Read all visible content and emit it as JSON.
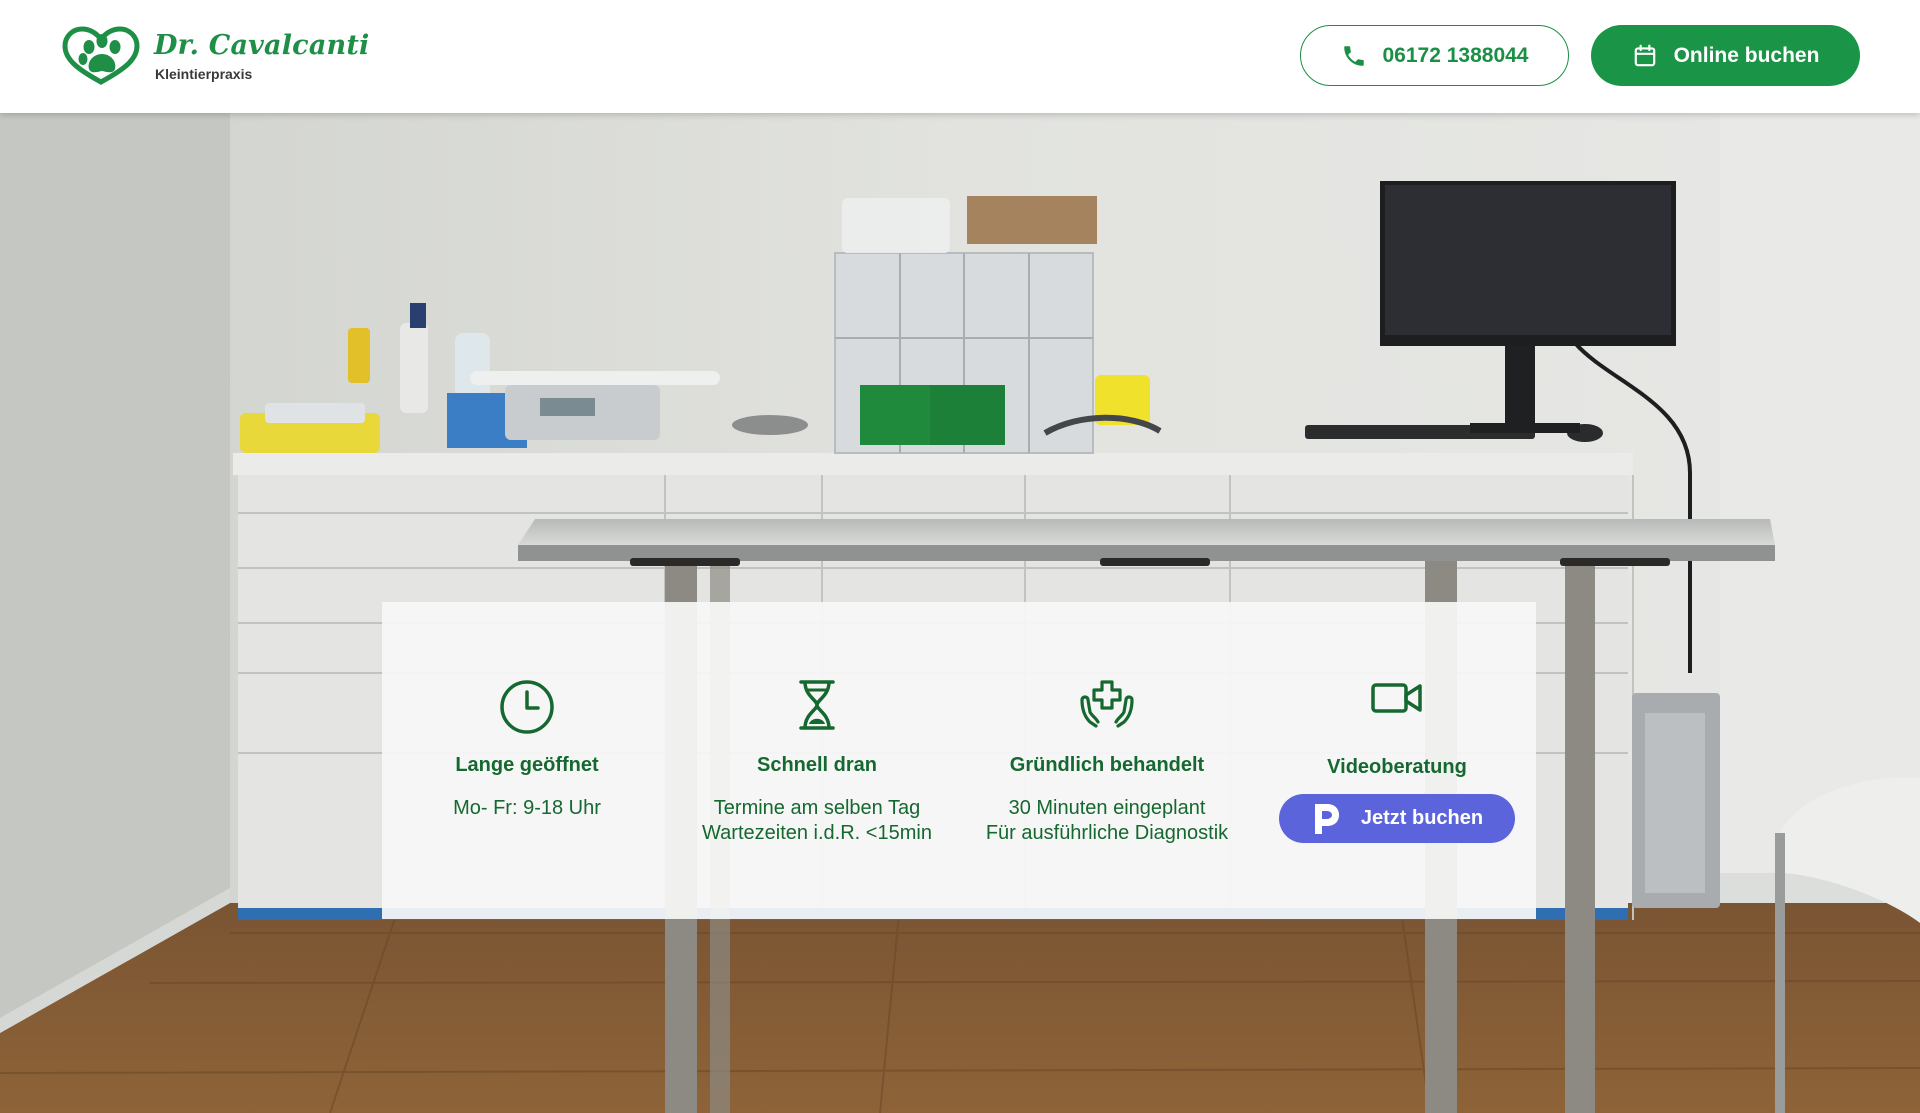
{
  "header": {
    "logo_name": "Dr. Cavalcanti",
    "logo_subtitle": "Kleintierpraxis",
    "phone_label": "06172 1388044",
    "book_label": "Online buchen"
  },
  "features": [
    {
      "icon": "clock-icon",
      "title": "Lange geöffnet",
      "lines": [
        "Mo- Fr: 9-18 Uhr"
      ]
    },
    {
      "icon": "hourglass-icon",
      "title": "Schnell dran",
      "lines": [
        "Termine am selben Tag",
        "Wartezeiten i.d.R. <15min"
      ]
    },
    {
      "icon": "hands-medical-cross-icon",
      "title": "Gründlich behandelt",
      "lines": [
        "30 Minuten eingeplant",
        "Für ausführliche Diagnostik"
      ]
    },
    {
      "icon": "video-camera-icon",
      "title": "Videoberatung",
      "button_label": "Jetzt buchen"
    }
  ],
  "colors": {
    "brand_green": "#1a9446",
    "text_green": "#15682f",
    "video_button": "#5b64db"
  }
}
